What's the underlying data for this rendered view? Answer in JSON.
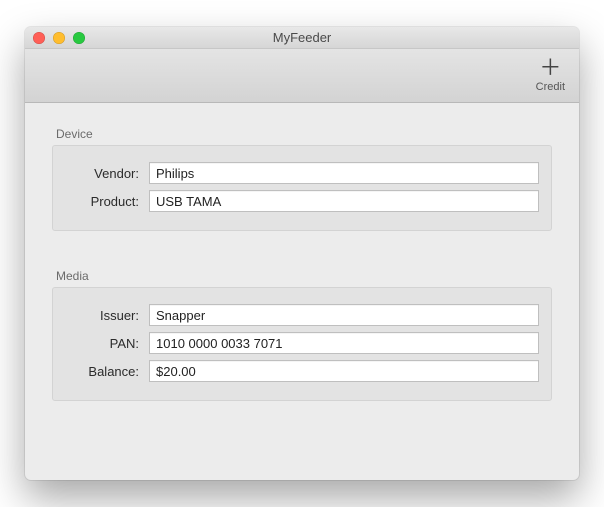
{
  "window": {
    "title": "MyFeeder"
  },
  "toolbar": {
    "credit": {
      "glyph": "＋",
      "label": "Credit"
    }
  },
  "device": {
    "section_label": "Device",
    "vendor_label": "Vendor:",
    "vendor_value": "Philips",
    "product_label": "Product:",
    "product_value": "USB TAMA"
  },
  "media": {
    "section_label": "Media",
    "issuer_label": "Issuer:",
    "issuer_value": "Snapper",
    "pan_label": "PAN:",
    "pan_value": "1010 0000 0033 7071",
    "balance_label": "Balance:",
    "balance_value": "$20.00"
  }
}
